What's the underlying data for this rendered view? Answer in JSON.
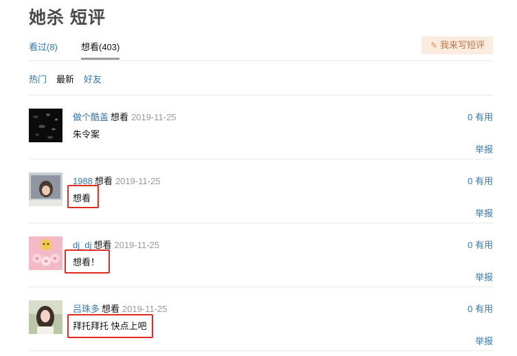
{
  "page": {
    "title": "她杀 短评"
  },
  "tabs": [
    {
      "label": "看过(8)"
    },
    {
      "label": "想看(403)"
    }
  ],
  "write_button": {
    "label": "我来写短评",
    "icon": "pencil-icon",
    "bg": "#fbece0",
    "color": "#c0744a"
  },
  "filters": [
    {
      "label": "热门"
    },
    {
      "label": "最新"
    },
    {
      "label": "好友"
    }
  ],
  "comments": [
    {
      "user": "做个酷盖",
      "status": "想看",
      "date": "2019-11-25",
      "content": "朱令案",
      "votes": "0 有用",
      "report": "举报"
    },
    {
      "user": "1988",
      "status": "想看",
      "date": "2019-11-25",
      "content": "想看",
      "votes": "0 有用",
      "report": "举报"
    },
    {
      "user": "dj_dj",
      "status": "想看",
      "date": "2019-11-25",
      "content": "想看！",
      "votes": "0 有用",
      "report": "举报"
    },
    {
      "user": "吕珠多",
      "status": "想看",
      "date": "2019-11-25",
      "content": "拜托拜托 快点上吧",
      "votes": "0 有用",
      "report": "举报"
    }
  ],
  "colors": {
    "link": "#37a",
    "highlight": "#e0291f"
  }
}
